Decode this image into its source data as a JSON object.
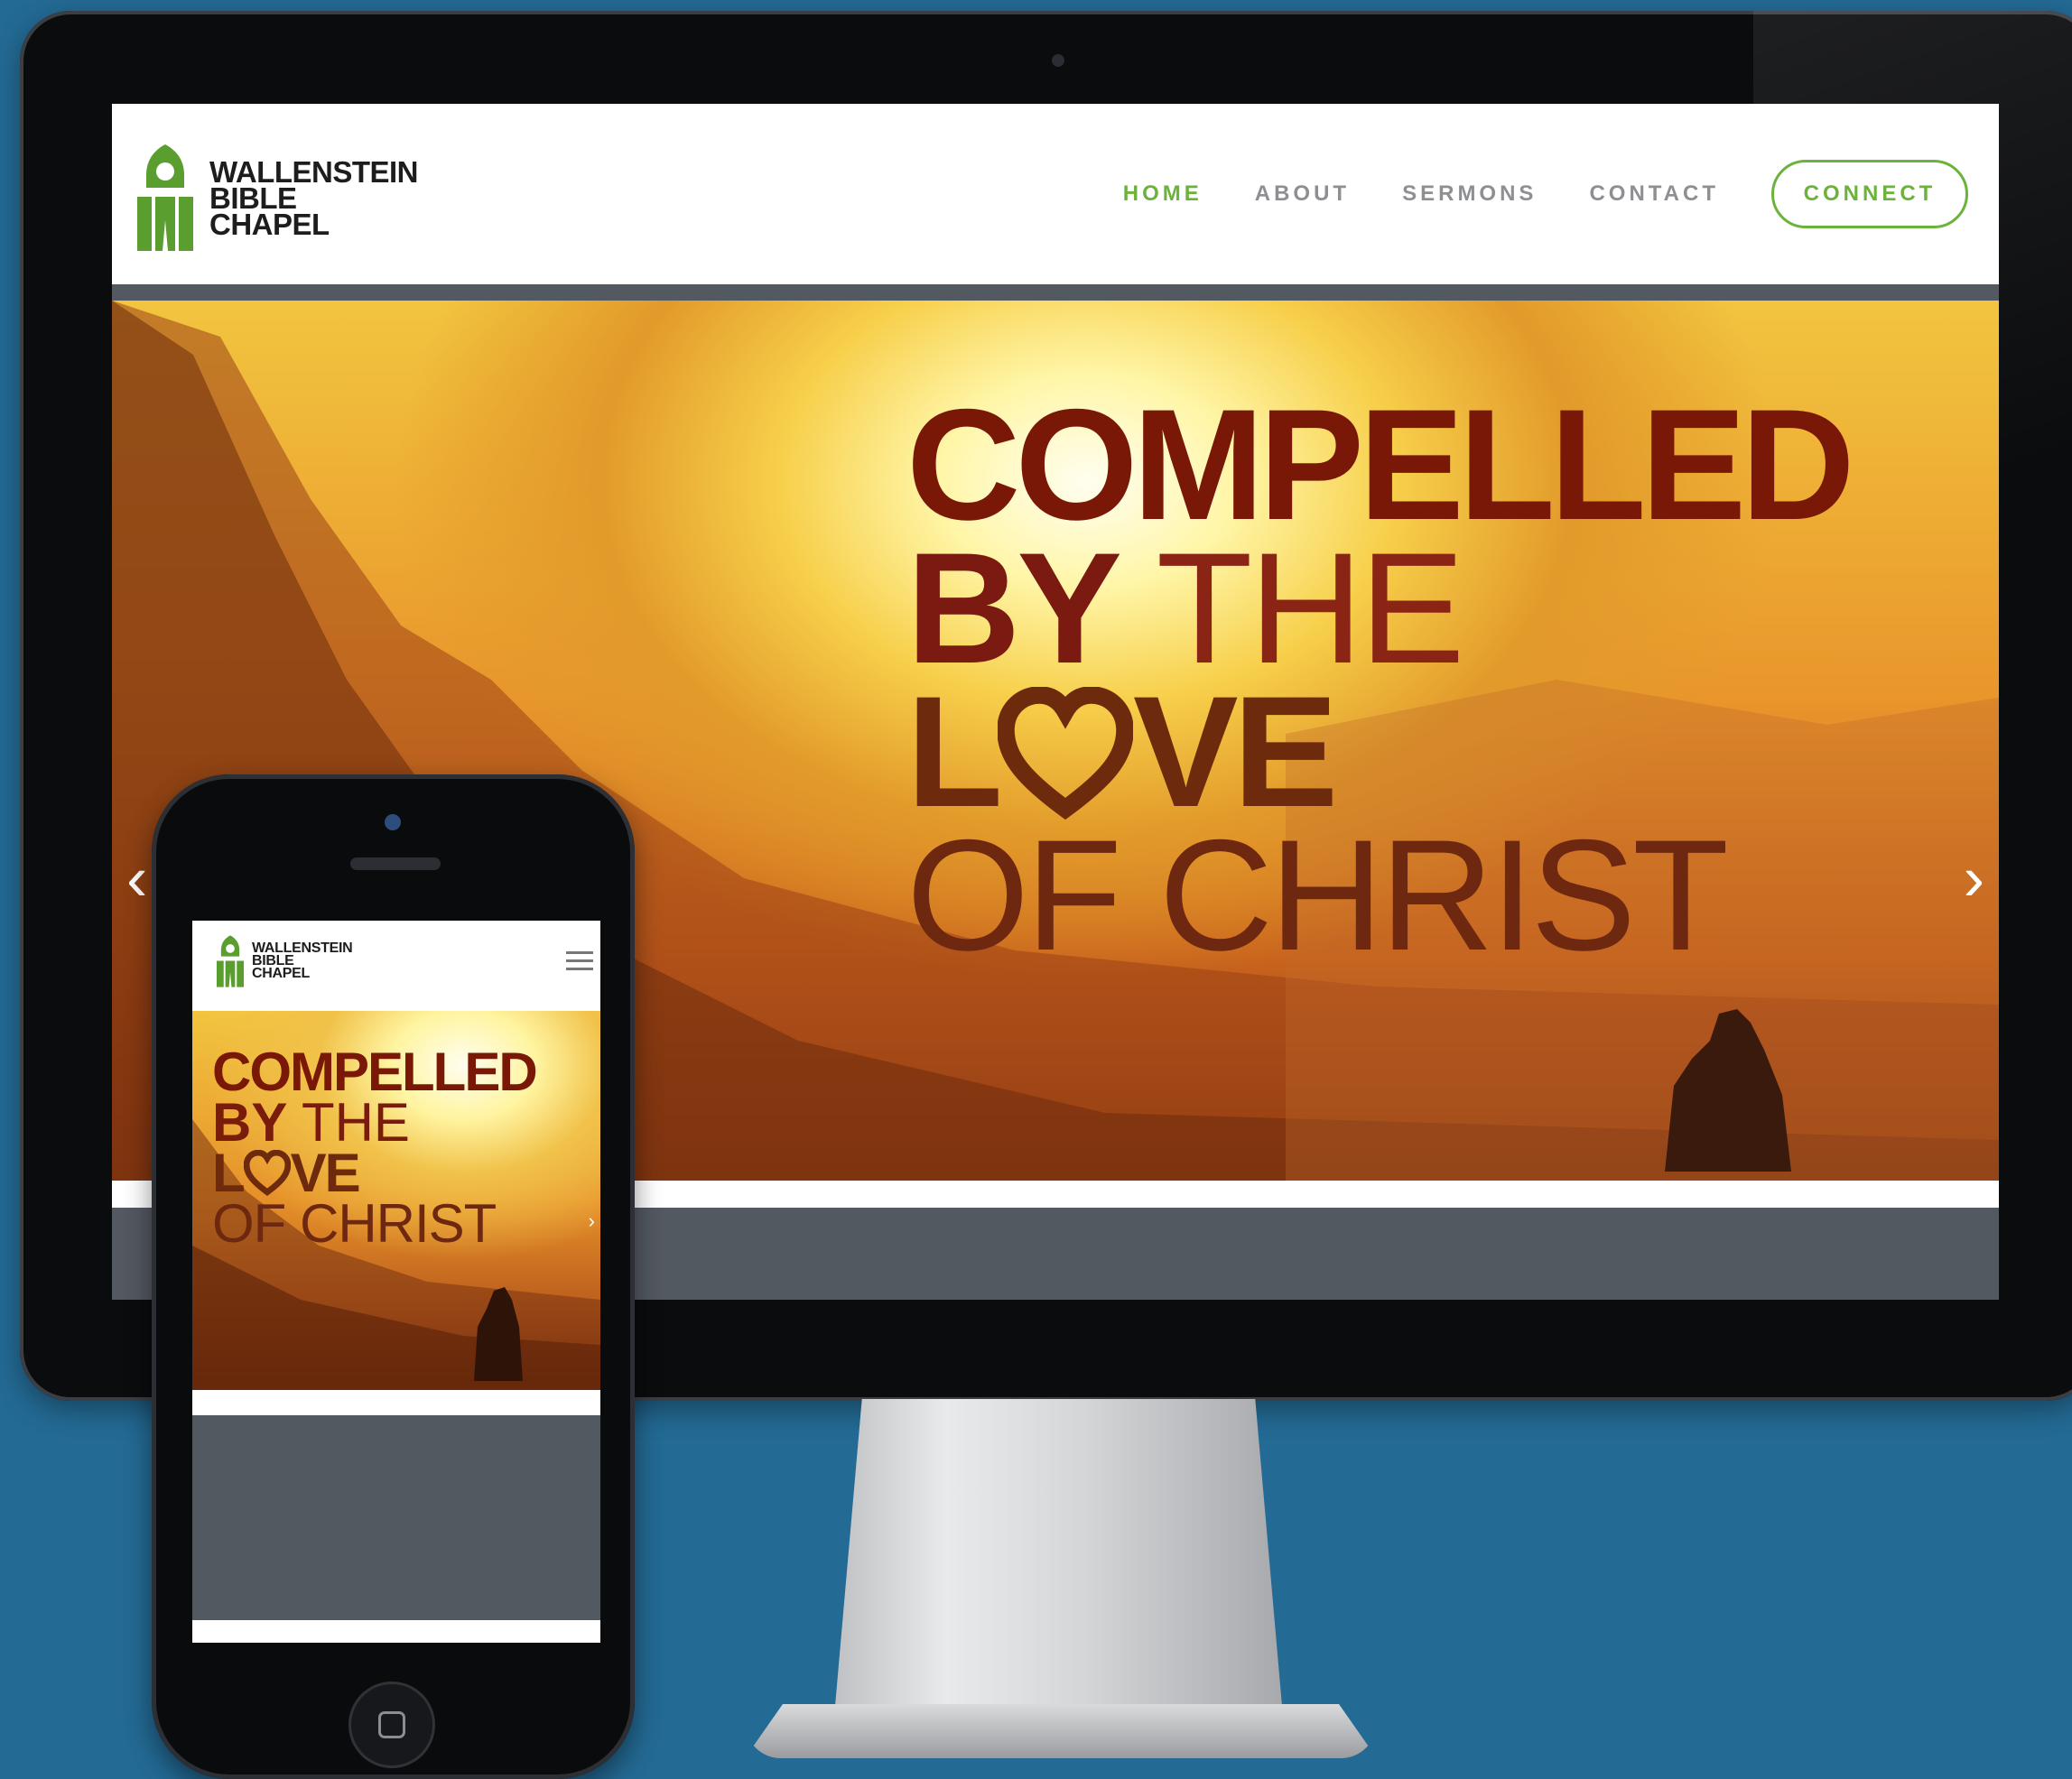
{
  "site": {
    "logo_lines": [
      "WALLENSTEIN",
      "BIBLE",
      "CHAPEL"
    ],
    "nav": [
      {
        "label": "HOME",
        "active": true
      },
      {
        "label": "ABOUT",
        "active": false
      },
      {
        "label": "SERMONS",
        "active": false
      },
      {
        "label": "CONTACT",
        "active": false
      }
    ],
    "connect_label": "CONNECT"
  },
  "hero": {
    "line1": "COMPELLED",
    "line2_bold": "BY",
    "line2_thin": "THE",
    "line3_pre": "L",
    "line3_post": "VE",
    "line4": "OF CHRIST",
    "left_arrow": "‹",
    "right_arrow": "›"
  },
  "icons": {
    "logo": "church-logo-icon",
    "heart": "heart-icon",
    "menu": "hamburger-menu-icon",
    "home": "home-button-icon"
  },
  "colors": {
    "background": "#236a94",
    "accent_green": "#6bb33a",
    "nav_gray": "#8d8f92",
    "title_red": "#7a1808"
  }
}
